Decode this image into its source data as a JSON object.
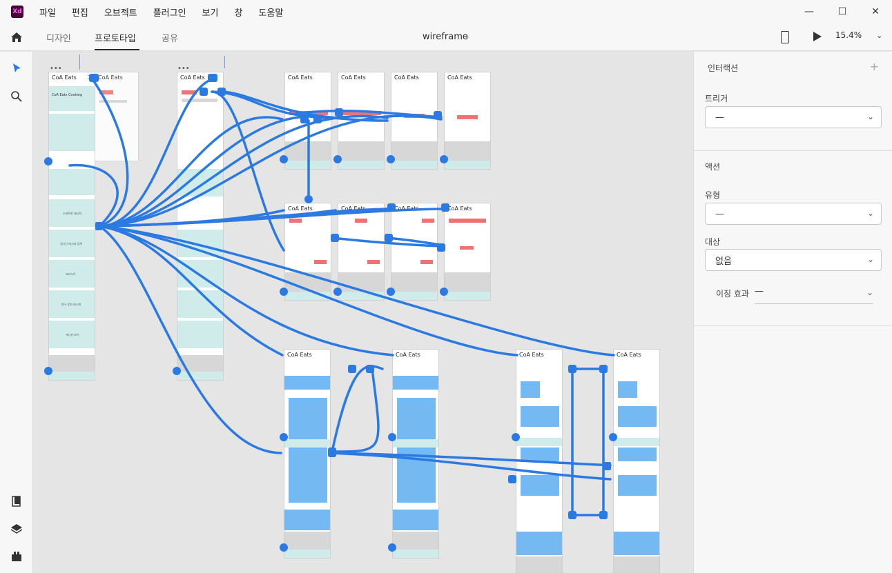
{
  "app": {
    "logo_text": "Xd",
    "menu": [
      "파일",
      "편집",
      "오브젝트",
      "플러그인",
      "보기",
      "창",
      "도움말"
    ],
    "window_controls": [
      "—",
      "☐",
      "✕"
    ]
  },
  "tabs": {
    "design": "디자인",
    "prototype": "프로토타입",
    "share": "공유",
    "active": "프로토타입"
  },
  "document": {
    "title": "wireframe",
    "zoom": "15.4%"
  },
  "tools": [
    "select-tool",
    "zoom-tool",
    "assets-panel",
    "layers-panel",
    "plugins-panel"
  ],
  "panel": {
    "interaction_heading": "인터랙션",
    "add_symbol": "+",
    "trigger_label": "트리거",
    "trigger_value": "—",
    "action_heading": "액션",
    "type_label": "유형",
    "type_value": "—",
    "destination_label": "대상",
    "destination_value": "없음",
    "easing_label": "이징 효과",
    "easing_value": "—"
  },
  "artboard": {
    "title": "CoA Eats",
    "dots": "•••",
    "cooking_title": "CoA Eats Cooking",
    "menu_items": [
      "스마트한 레시피",
      "실시간 레시피 검색",
      "요리노트",
      "친구 추천 레시피",
      "게시판 보기"
    ]
  },
  "colors": {
    "accent": "#2a7ae2",
    "teal": "#cfecea",
    "coral": "#f07373",
    "blue": "#74b9f2"
  }
}
